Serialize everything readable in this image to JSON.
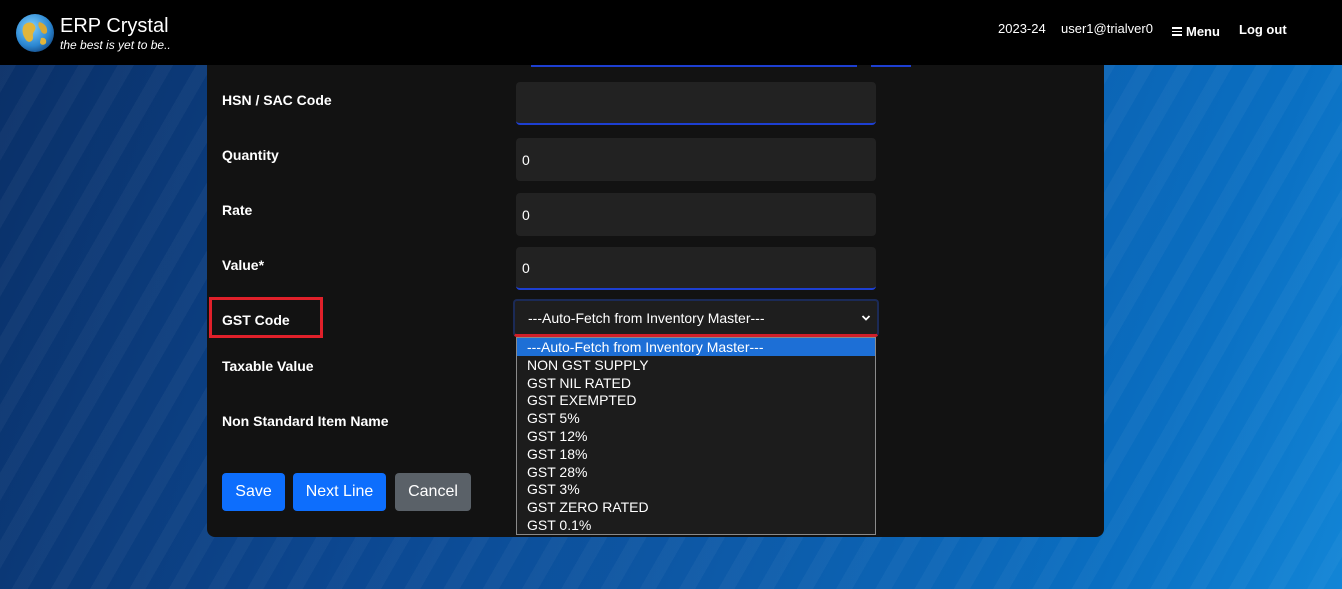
{
  "header": {
    "brand_name": "ERP Crystal",
    "tagline": "the best is yet to be..",
    "financial_year": "2023-24",
    "user": "user1@trialver0",
    "menu_label": "Menu",
    "logout_label": "Log out"
  },
  "form": {
    "hsn_label": "HSN / SAC Code",
    "hsn_value": "",
    "quantity_label": "Quantity",
    "quantity_value": "0",
    "rate_label": "Rate",
    "rate_value": "0",
    "value_label": "Value*",
    "value_value": "0",
    "gst_label": "GST Code",
    "gst_selected": "---Auto-Fetch from Inventory Master---",
    "taxable_label": "Taxable Value",
    "nonstandard_label": "Non Standard Item Name"
  },
  "buttons": {
    "save": "Save",
    "next_line": "Next Line",
    "cancel": "Cancel"
  },
  "gst_options": [
    "---Auto-Fetch from Inventory Master---",
    "NON GST SUPPLY",
    "GST NIL RATED",
    "GST EXEMPTED",
    "GST 5%",
    "GST 12%",
    "GST 18%",
    "GST 28%",
    "GST 3%",
    "GST ZERO RATED",
    "GST 0.1%"
  ],
  "colors": {
    "accent": "#0d6efd",
    "highlight": "#e0202a",
    "selected_option": "#1d6fd6"
  },
  "icons": {
    "logo": "globe-icon",
    "menu": "hamburger-icon",
    "select": "chevron-down-icon"
  }
}
